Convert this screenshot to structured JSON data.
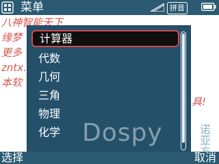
{
  "header": {
    "title": "菜单",
    "input_method": "拼音",
    "icons": {
      "menu": "menu-icon",
      "signal": "signal-icon",
      "battery": "battery-icon"
    }
  },
  "background": {
    "lines": [
      "八神智能天下",
      "缘梦",
      "更多",
      "zntx.",
      "本软"
    ],
    "suffix": "具!"
  },
  "menu": {
    "items": [
      {
        "label": "计算器",
        "selected": true
      },
      {
        "label": "代数"
      },
      {
        "label": "几何"
      },
      {
        "label": "三角"
      },
      {
        "label": "物理"
      },
      {
        "label": "化学"
      }
    ]
  },
  "watermark": {
    "text": "Dospy",
    "side_top": "诺亚",
    "side_bottom": "方"
  },
  "softkeys": {
    "left": "选择",
    "right": "取消"
  },
  "colors": {
    "bar": "#2b5a72",
    "panel": "#24506a",
    "selection_border": "#d64a4a",
    "background_text": "#d4574f"
  }
}
